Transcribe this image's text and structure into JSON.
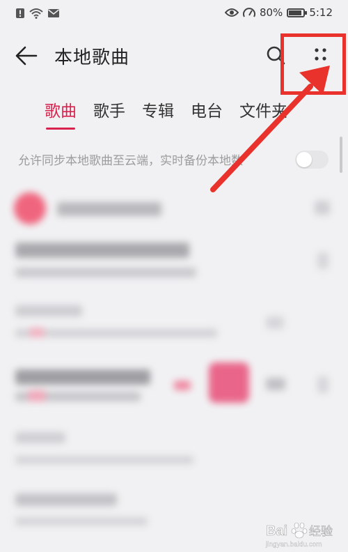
{
  "status_bar": {
    "battery": "80%",
    "battery_level": 0.8,
    "time": "5:12"
  },
  "header": {
    "title": "本地歌曲",
    "back_icon": "arrow-left-icon",
    "search_icon": "search-icon",
    "more_icon": "more-dots-icon"
  },
  "tabs": [
    {
      "label": "歌曲",
      "active": true
    },
    {
      "label": "歌手",
      "active": false
    },
    {
      "label": "专辑",
      "active": false
    },
    {
      "label": "电台",
      "active": false
    },
    {
      "label": "文件夹",
      "active": false
    }
  ],
  "sync": {
    "label": "允许同步本地歌曲至云端，实时备份本地数",
    "enabled": false
  },
  "colors": {
    "accent": "#d8224d",
    "annotation": "#e8322b",
    "play_all": "#f0657e"
  },
  "watermark": {
    "text": "Bai 经验",
    "sub": "jingyan.baidu.com"
  }
}
